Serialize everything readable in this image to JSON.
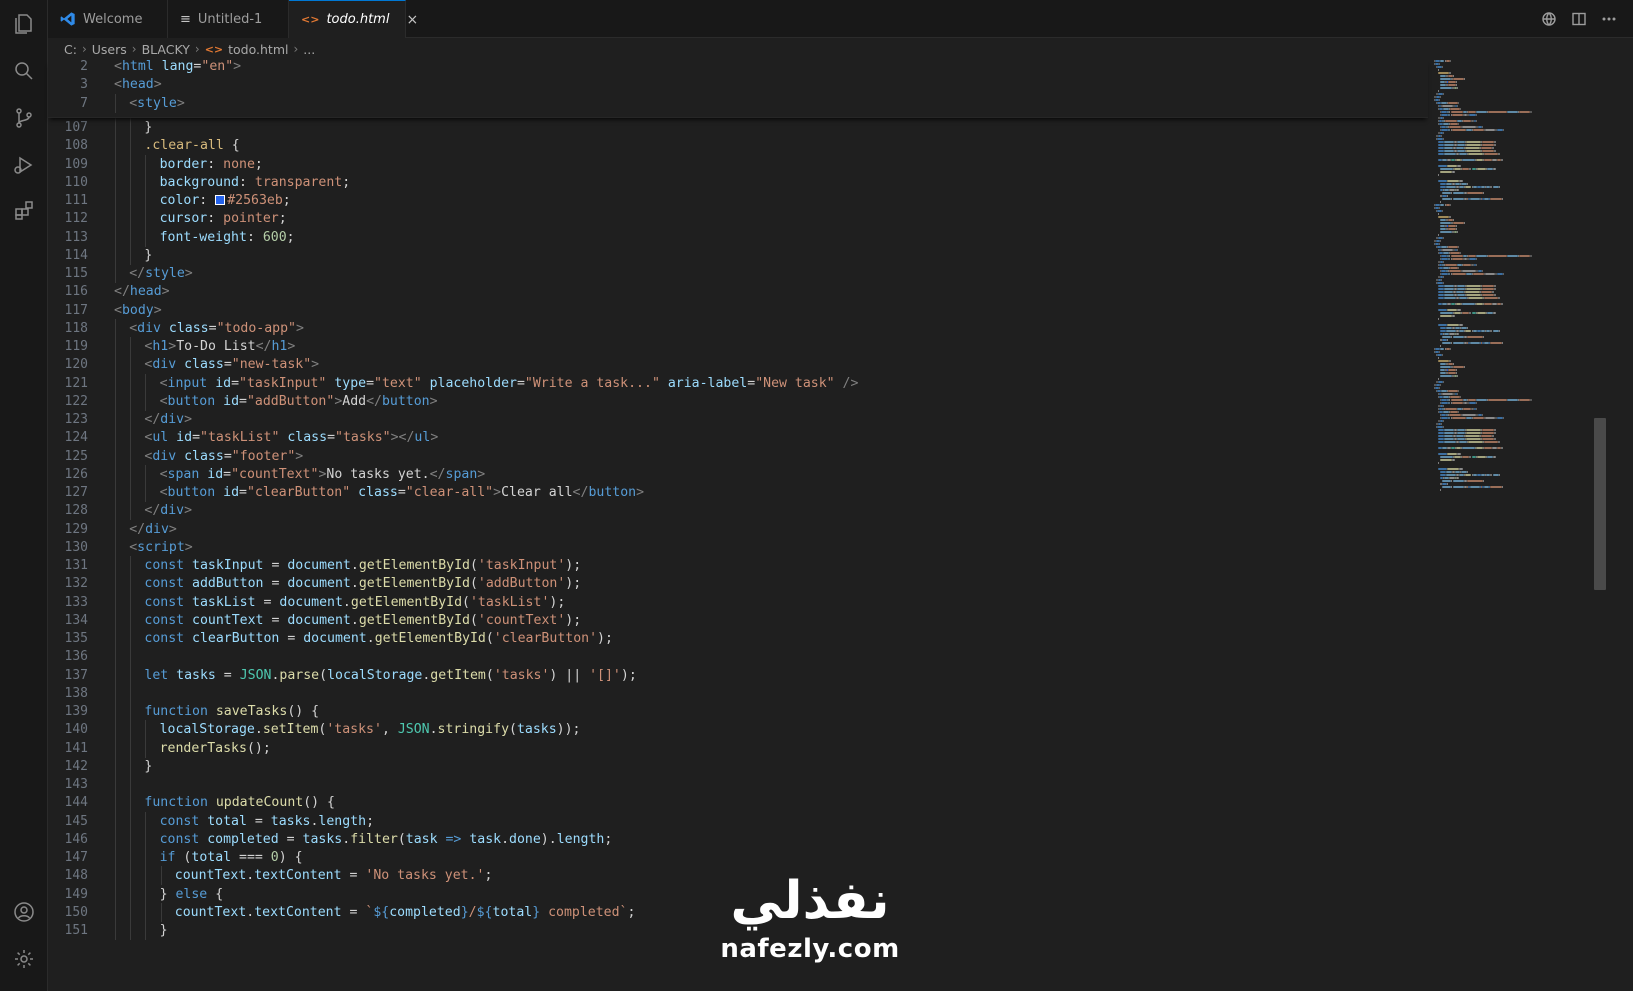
{
  "tabs": [
    {
      "label": "Welcome",
      "icon": "vscode-logo-icon",
      "active": false
    },
    {
      "label": "Untitled-1",
      "icon": "file-lines-icon",
      "active": false
    },
    {
      "label": "todo.html",
      "icon": "html-file-icon",
      "active": true
    }
  ],
  "tab_close": "×",
  "breadcrumb": {
    "root": "C:",
    "folder": "Users",
    "user": "BLACKY",
    "file_glyph": "<>",
    "file": "todo.html",
    "more": "..."
  },
  "watermark": {
    "arabic": "نفذلي",
    "latin": "nafezly.com"
  },
  "colors": {
    "accent": "#0078d4",
    "swatch": "#2563eb"
  },
  "sticky_lines": [
    {
      "n": "2",
      "indent": 0,
      "tokens": [
        [
          "pn",
          "<"
        ],
        [
          "tg",
          "html "
        ],
        [
          "at",
          "lang"
        ],
        [
          "tx",
          "="
        ],
        [
          "st",
          "\"en\""
        ],
        [
          "pn",
          ">"
        ]
      ]
    },
    {
      "n": "3",
      "indent": 0,
      "tokens": [
        [
          "pn",
          "<"
        ],
        [
          "tg",
          "head"
        ],
        [
          "pn",
          ">"
        ]
      ]
    },
    {
      "n": "7",
      "indent": 1,
      "tokens": [
        [
          "pn",
          "<"
        ],
        [
          "tg",
          "style"
        ],
        [
          "pn",
          ">"
        ]
      ]
    }
  ],
  "code_lines": [
    {
      "n": "107",
      "indent": 2,
      "tokens": [
        [
          "tx",
          "}"
        ]
      ]
    },
    {
      "n": "108",
      "indent": 2,
      "tokens": [
        [
          "sel",
          ".clear-all"
        ],
        [
          "tx",
          " {"
        ]
      ]
    },
    {
      "n": "109",
      "indent": 3,
      "tokens": [
        [
          "pr",
          "border"
        ],
        [
          "tx",
          ": "
        ],
        [
          "vl",
          "none"
        ],
        [
          "tx",
          ";"
        ]
      ]
    },
    {
      "n": "110",
      "indent": 3,
      "tokens": [
        [
          "pr",
          "background"
        ],
        [
          "tx",
          ": "
        ],
        [
          "vl",
          "transparent"
        ],
        [
          "tx",
          ";"
        ]
      ]
    },
    {
      "n": "111",
      "indent": 3,
      "tokens": [
        [
          "pr",
          "color"
        ],
        [
          "tx",
          ": "
        ],
        [
          "swatch",
          ""
        ],
        [
          "vl",
          "#2563eb"
        ],
        [
          "tx",
          ";"
        ]
      ]
    },
    {
      "n": "112",
      "indent": 3,
      "tokens": [
        [
          "pr",
          "cursor"
        ],
        [
          "tx",
          ": "
        ],
        [
          "vl",
          "pointer"
        ],
        [
          "tx",
          ";"
        ]
      ]
    },
    {
      "n": "113",
      "indent": 3,
      "tokens": [
        [
          "pr",
          "font-weight"
        ],
        [
          "tx",
          ": "
        ],
        [
          "nm",
          "600"
        ],
        [
          "tx",
          ";"
        ]
      ]
    },
    {
      "n": "114",
      "indent": 2,
      "tokens": [
        [
          "tx",
          "}"
        ]
      ]
    },
    {
      "n": "115",
      "indent": 1,
      "tokens": [
        [
          "pn",
          "</"
        ],
        [
          "tg",
          "style"
        ],
        [
          "pn",
          ">"
        ]
      ]
    },
    {
      "n": "116",
      "indent": 0,
      "tokens": [
        [
          "pn",
          "</"
        ],
        [
          "tg",
          "head"
        ],
        [
          "pn",
          ">"
        ]
      ]
    },
    {
      "n": "117",
      "indent": 0,
      "tokens": [
        [
          "pn",
          "<"
        ],
        [
          "tg",
          "body"
        ],
        [
          "pn",
          ">"
        ]
      ]
    },
    {
      "n": "118",
      "indent": 1,
      "tokens": [
        [
          "pn",
          "<"
        ],
        [
          "tg",
          "div "
        ],
        [
          "at",
          "class"
        ],
        [
          "tx",
          "="
        ],
        [
          "st",
          "\"todo-app\""
        ],
        [
          "pn",
          ">"
        ]
      ]
    },
    {
      "n": "119",
      "indent": 2,
      "tokens": [
        [
          "pn",
          "<"
        ],
        [
          "tg",
          "h1"
        ],
        [
          "pn",
          ">"
        ],
        [
          "tx",
          "To-Do List"
        ],
        [
          "pn",
          "</"
        ],
        [
          "tg",
          "h1"
        ],
        [
          "pn",
          ">"
        ]
      ]
    },
    {
      "n": "120",
      "indent": 2,
      "tokens": [
        [
          "pn",
          "<"
        ],
        [
          "tg",
          "div "
        ],
        [
          "at",
          "class"
        ],
        [
          "tx",
          "="
        ],
        [
          "st",
          "\"new-task\""
        ],
        [
          "pn",
          ">"
        ]
      ]
    },
    {
      "n": "121",
      "indent": 3,
      "tokens": [
        [
          "pn",
          "<"
        ],
        [
          "tg",
          "input "
        ],
        [
          "at",
          "id"
        ],
        [
          "tx",
          "="
        ],
        [
          "st",
          "\"taskInput\" "
        ],
        [
          "at",
          "type"
        ],
        [
          "tx",
          "="
        ],
        [
          "st",
          "\"text\" "
        ],
        [
          "at",
          "placeholder"
        ],
        [
          "tx",
          "="
        ],
        [
          "st",
          "\"Write a task...\" "
        ],
        [
          "at",
          "aria-label"
        ],
        [
          "tx",
          "="
        ],
        [
          "st",
          "\"New task\" "
        ],
        [
          "pn",
          "/>"
        ]
      ]
    },
    {
      "n": "122",
      "indent": 3,
      "tokens": [
        [
          "pn",
          "<"
        ],
        [
          "tg",
          "button "
        ],
        [
          "at",
          "id"
        ],
        [
          "tx",
          "="
        ],
        [
          "st",
          "\"addButton\""
        ],
        [
          "pn",
          ">"
        ],
        [
          "tx",
          "Add"
        ],
        [
          "pn",
          "</"
        ],
        [
          "tg",
          "button"
        ],
        [
          "pn",
          ">"
        ]
      ]
    },
    {
      "n": "123",
      "indent": 2,
      "tokens": [
        [
          "pn",
          "</"
        ],
        [
          "tg",
          "div"
        ],
        [
          "pn",
          ">"
        ]
      ]
    },
    {
      "n": "124",
      "indent": 2,
      "tokens": [
        [
          "pn",
          "<"
        ],
        [
          "tg",
          "ul "
        ],
        [
          "at",
          "id"
        ],
        [
          "tx",
          "="
        ],
        [
          "st",
          "\"taskList\" "
        ],
        [
          "at",
          "class"
        ],
        [
          "tx",
          "="
        ],
        [
          "st",
          "\"tasks\""
        ],
        [
          "pn",
          "></"
        ],
        [
          "tg",
          "ul"
        ],
        [
          "pn",
          ">"
        ]
      ]
    },
    {
      "n": "125",
      "indent": 2,
      "tokens": [
        [
          "pn",
          "<"
        ],
        [
          "tg",
          "div "
        ],
        [
          "at",
          "class"
        ],
        [
          "tx",
          "="
        ],
        [
          "st",
          "\"footer\""
        ],
        [
          "pn",
          ">"
        ]
      ]
    },
    {
      "n": "126",
      "indent": 3,
      "tokens": [
        [
          "pn",
          "<"
        ],
        [
          "tg",
          "span "
        ],
        [
          "at",
          "id"
        ],
        [
          "tx",
          "="
        ],
        [
          "st",
          "\"countText\""
        ],
        [
          "pn",
          ">"
        ],
        [
          "tx",
          "No tasks yet."
        ],
        [
          "pn",
          "</"
        ],
        [
          "tg",
          "span"
        ],
        [
          "pn",
          ">"
        ]
      ]
    },
    {
      "n": "127",
      "indent": 3,
      "tokens": [
        [
          "pn",
          "<"
        ],
        [
          "tg",
          "button "
        ],
        [
          "at",
          "id"
        ],
        [
          "tx",
          "="
        ],
        [
          "st",
          "\"clearButton\" "
        ],
        [
          "at",
          "class"
        ],
        [
          "tx",
          "="
        ],
        [
          "st",
          "\"clear-all\""
        ],
        [
          "pn",
          ">"
        ],
        [
          "tx",
          "Clear all"
        ],
        [
          "pn",
          "</"
        ],
        [
          "tg",
          "button"
        ],
        [
          "pn",
          ">"
        ]
      ]
    },
    {
      "n": "128",
      "indent": 2,
      "tokens": [
        [
          "pn",
          "</"
        ],
        [
          "tg",
          "div"
        ],
        [
          "pn",
          ">"
        ]
      ]
    },
    {
      "n": "129",
      "indent": 1,
      "tokens": [
        [
          "pn",
          "</"
        ],
        [
          "tg",
          "div"
        ],
        [
          "pn",
          ">"
        ]
      ]
    },
    {
      "n": "130",
      "indent": 1,
      "tokens": [
        [
          "pn",
          "<"
        ],
        [
          "tg",
          "script"
        ],
        [
          "pn",
          ">"
        ]
      ]
    },
    {
      "n": "131",
      "indent": 2,
      "tokens": [
        [
          "kw",
          "const "
        ],
        [
          "vr",
          "taskInput"
        ],
        [
          "tx",
          " = "
        ],
        [
          "vr",
          "document"
        ],
        [
          "tx",
          "."
        ],
        [
          "fn",
          "getElementById"
        ],
        [
          "tx",
          "("
        ],
        [
          "st",
          "'taskInput'"
        ],
        [
          "tx",
          ");"
        ]
      ]
    },
    {
      "n": "132",
      "indent": 2,
      "tokens": [
        [
          "kw",
          "const "
        ],
        [
          "vr",
          "addButton"
        ],
        [
          "tx",
          " = "
        ],
        [
          "vr",
          "document"
        ],
        [
          "tx",
          "."
        ],
        [
          "fn",
          "getElementById"
        ],
        [
          "tx",
          "("
        ],
        [
          "st",
          "'addButton'"
        ],
        [
          "tx",
          ");"
        ]
      ]
    },
    {
      "n": "133",
      "indent": 2,
      "tokens": [
        [
          "kw",
          "const "
        ],
        [
          "vr",
          "taskList"
        ],
        [
          "tx",
          " = "
        ],
        [
          "vr",
          "document"
        ],
        [
          "tx",
          "."
        ],
        [
          "fn",
          "getElementById"
        ],
        [
          "tx",
          "("
        ],
        [
          "st",
          "'taskList'"
        ],
        [
          "tx",
          ");"
        ]
      ]
    },
    {
      "n": "134",
      "indent": 2,
      "tokens": [
        [
          "kw",
          "const "
        ],
        [
          "vr",
          "countText"
        ],
        [
          "tx",
          " = "
        ],
        [
          "vr",
          "document"
        ],
        [
          "tx",
          "."
        ],
        [
          "fn",
          "getElementById"
        ],
        [
          "tx",
          "("
        ],
        [
          "st",
          "'countText'"
        ],
        [
          "tx",
          ");"
        ]
      ]
    },
    {
      "n": "135",
      "indent": 2,
      "tokens": [
        [
          "kw",
          "const "
        ],
        [
          "vr",
          "clearButton"
        ],
        [
          "tx",
          " = "
        ],
        [
          "vr",
          "document"
        ],
        [
          "tx",
          "."
        ],
        [
          "fn",
          "getElementById"
        ],
        [
          "tx",
          "("
        ],
        [
          "st",
          "'clearButton'"
        ],
        [
          "tx",
          ");"
        ]
      ]
    },
    {
      "n": "136",
      "indent": 0,
      "tokens": []
    },
    {
      "n": "137",
      "indent": 2,
      "tokens": [
        [
          "kw",
          "let "
        ],
        [
          "vr",
          "tasks"
        ],
        [
          "tx",
          " = "
        ],
        [
          "cl",
          "JSON"
        ],
        [
          "tx",
          "."
        ],
        [
          "fn",
          "parse"
        ],
        [
          "tx",
          "("
        ],
        [
          "vr",
          "localStorage"
        ],
        [
          "tx",
          "."
        ],
        [
          "fn",
          "getItem"
        ],
        [
          "tx",
          "("
        ],
        [
          "st",
          "'tasks'"
        ],
        [
          "tx",
          ") || "
        ],
        [
          "st",
          "'[]'"
        ],
        [
          "tx",
          ");"
        ]
      ]
    },
    {
      "n": "138",
      "indent": 0,
      "tokens": []
    },
    {
      "n": "139",
      "indent": 2,
      "tokens": [
        [
          "kw",
          "function "
        ],
        [
          "fn",
          "saveTasks"
        ],
        [
          "tx",
          "() {"
        ]
      ]
    },
    {
      "n": "140",
      "indent": 3,
      "tokens": [
        [
          "vr",
          "localStorage"
        ],
        [
          "tx",
          "."
        ],
        [
          "fn",
          "setItem"
        ],
        [
          "tx",
          "("
        ],
        [
          "st",
          "'tasks'"
        ],
        [
          "tx",
          ", "
        ],
        [
          "cl",
          "JSON"
        ],
        [
          "tx",
          "."
        ],
        [
          "fn",
          "stringify"
        ],
        [
          "tx",
          "("
        ],
        [
          "vr",
          "tasks"
        ],
        [
          "tx",
          "));"
        ]
      ]
    },
    {
      "n": "141",
      "indent": 3,
      "tokens": [
        [
          "fn",
          "renderTasks"
        ],
        [
          "tx",
          "();"
        ]
      ]
    },
    {
      "n": "142",
      "indent": 2,
      "tokens": [
        [
          "tx",
          "}"
        ]
      ]
    },
    {
      "n": "143",
      "indent": 0,
      "tokens": []
    },
    {
      "n": "144",
      "indent": 2,
      "tokens": [
        [
          "kw",
          "function "
        ],
        [
          "fn",
          "updateCount"
        ],
        [
          "tx",
          "() {"
        ]
      ]
    },
    {
      "n": "145",
      "indent": 3,
      "tokens": [
        [
          "kw",
          "const "
        ],
        [
          "vr",
          "total"
        ],
        [
          "tx",
          " = "
        ],
        [
          "vr",
          "tasks"
        ],
        [
          "tx",
          "."
        ],
        [
          "vr",
          "length"
        ],
        [
          "tx",
          ";"
        ]
      ]
    },
    {
      "n": "146",
      "indent": 3,
      "tokens": [
        [
          "kw",
          "const "
        ],
        [
          "vr",
          "completed"
        ],
        [
          "tx",
          " = "
        ],
        [
          "vr",
          "tasks"
        ],
        [
          "tx",
          "."
        ],
        [
          "fn",
          "filter"
        ],
        [
          "tx",
          "("
        ],
        [
          "vr",
          "task"
        ],
        [
          "kw",
          " => "
        ],
        [
          "vr",
          "task"
        ],
        [
          "tx",
          "."
        ],
        [
          "vr",
          "done"
        ],
        [
          "tx",
          ")."
        ],
        [
          "vr",
          "length"
        ],
        [
          "tx",
          ";"
        ]
      ]
    },
    {
      "n": "147",
      "indent": 3,
      "tokens": [
        [
          "kw",
          "if "
        ],
        [
          "tx",
          "("
        ],
        [
          "vr",
          "total"
        ],
        [
          "tx",
          " === "
        ],
        [
          "nm",
          "0"
        ],
        [
          "tx",
          ") {"
        ]
      ]
    },
    {
      "n": "148",
      "indent": 4,
      "tokens": [
        [
          "vr",
          "countText"
        ],
        [
          "tx",
          "."
        ],
        [
          "vr",
          "textContent"
        ],
        [
          "tx",
          " = "
        ],
        [
          "st",
          "'No tasks yet.'"
        ],
        [
          "tx",
          ";"
        ]
      ]
    },
    {
      "n": "149",
      "indent": 3,
      "tokens": [
        [
          "tx",
          "} "
        ],
        [
          "kw",
          "else "
        ],
        [
          "tx",
          "{"
        ]
      ]
    },
    {
      "n": "150",
      "indent": 4,
      "tokens": [
        [
          "vr",
          "countText"
        ],
        [
          "tx",
          "."
        ],
        [
          "vr",
          "textContent"
        ],
        [
          "tx",
          " = "
        ],
        [
          "st",
          "`"
        ],
        [
          "kw",
          "${"
        ],
        [
          "vr",
          "completed"
        ],
        [
          "kw",
          "}"
        ],
        [
          "st",
          "/"
        ],
        [
          "kw",
          "${"
        ],
        [
          "vr",
          "total"
        ],
        [
          "kw",
          "}"
        ],
        [
          "st",
          " completed`"
        ],
        [
          "tx",
          ";"
        ]
      ]
    },
    {
      "n": "151",
      "indent": 3,
      "tokens": [
        [
          "tx",
          "}"
        ]
      ]
    }
  ]
}
